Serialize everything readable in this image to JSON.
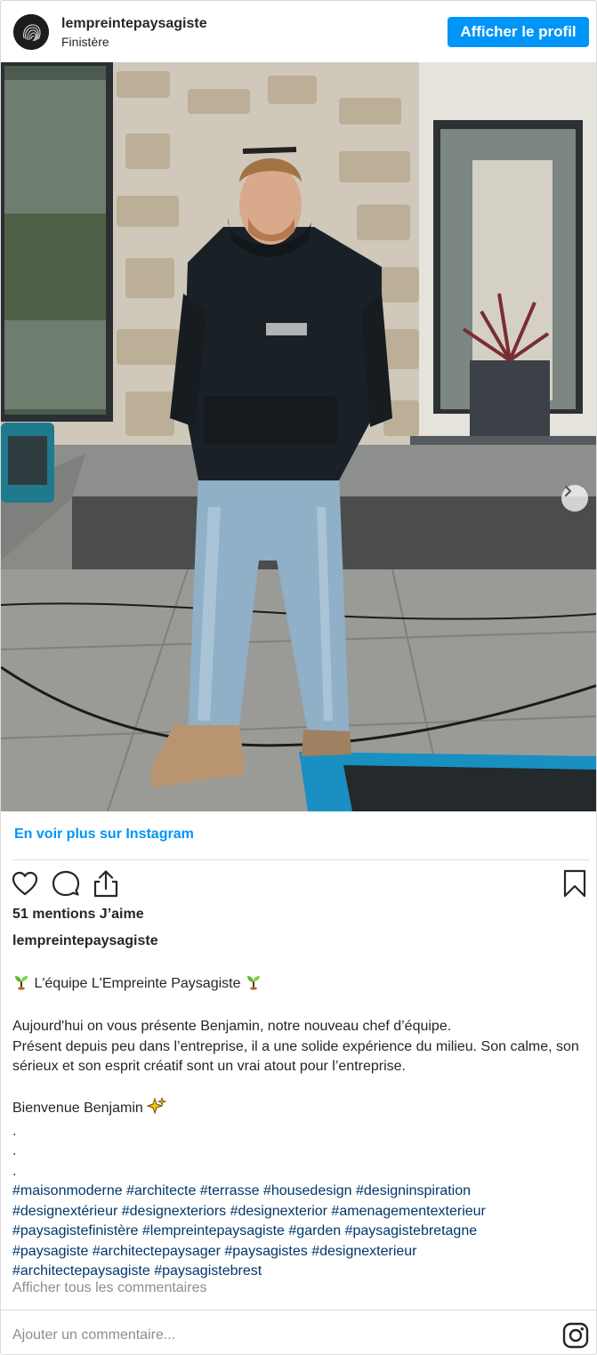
{
  "header": {
    "username": "lempreintepaysagiste",
    "location": "Finistère",
    "profile_button": "Afficher le profil"
  },
  "photo": {
    "alt": "Jeune homme debout sur une terrasse devant une maison en pierre",
    "slide_count": 2,
    "active_slide": 1
  },
  "links": {
    "see_more": "En voir plus sur Instagram"
  },
  "actions": {
    "like_icon": "heart-icon",
    "comment_icon": "comment-icon",
    "share_icon": "share-icon",
    "save_icon": "bookmark-icon"
  },
  "likes": "51 mentions J’aime",
  "caption": {
    "username": "lempreintepaysagiste",
    "title": "L'équipe L'Empreinte Paysagiste",
    "line1": "Aujourd'hui on vous présente Benjamin, notre nouveau chef d’équipe.",
    "line2": "Présent depuis peu dans l’entreprise, il a une solide expérience du milieu. Son calme, son sérieux et son esprit créatif sont un vrai atout pour l’entreprise.",
    "welcome": "Bienvenue Benjamin",
    "dots": [
      ".",
      ".",
      "."
    ],
    "hashtags_1": "#maisonmoderne #architecte #terrasse #housedesign #designinspiration",
    "hashtags_2": "#designextérieur #designexteriors #designexterior #amenagementexterieur",
    "hashtags_3": "#paysagistefinistère #lempreintepaysagiste #garden #paysagistebretagne",
    "hashtags_4": "#paysagiste #architectepaysager #paysagistes #designexterieur",
    "hashtags_5": "#architectepaysagiste #paysagistebrest"
  },
  "view_comments": "Afficher tous les commentaires",
  "comment_placeholder": "Ajouter un commentaire...",
  "colors": {
    "accent": "#0095f6",
    "hashtag": "#00376b",
    "muted": "#8e8e8e",
    "text": "#262626"
  }
}
